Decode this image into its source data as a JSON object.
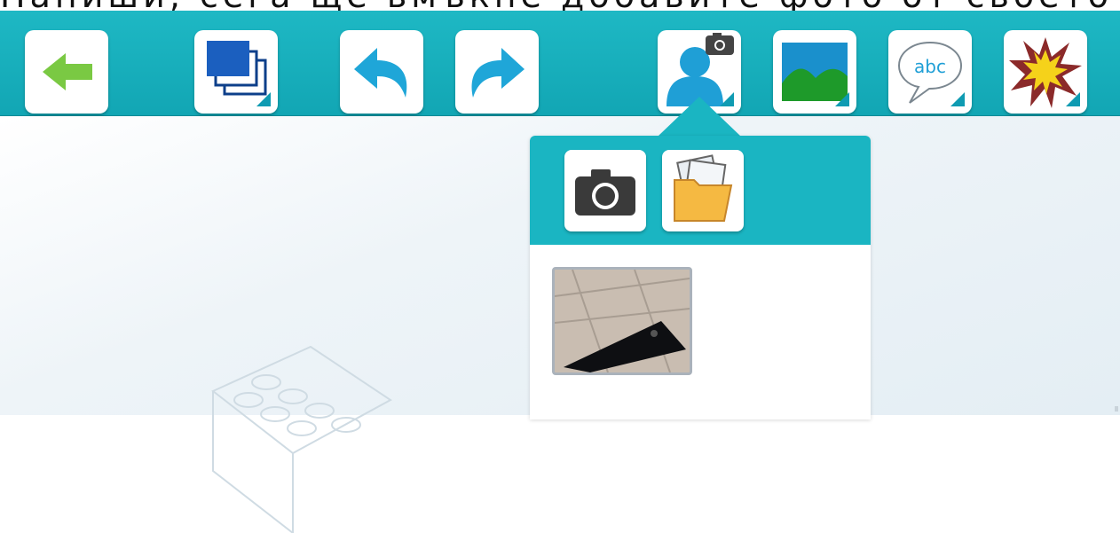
{
  "caption": {
    "text": "Напиши, сега ще вмъкне добавите фото от своето устройство"
  },
  "toolbar": {
    "buttons": [
      {
        "id": "back",
        "icon": "arrow-left-icon"
      },
      {
        "id": "layers",
        "icon": "layers-icon"
      },
      {
        "id": "undo",
        "icon": "undo-icon"
      },
      {
        "id": "redo",
        "icon": "redo-icon"
      },
      {
        "id": "character",
        "icon": "person-camera-icon"
      },
      {
        "id": "background",
        "icon": "landscape-icon"
      },
      {
        "id": "text",
        "icon": "speech-bubble-icon",
        "label": "abc"
      },
      {
        "id": "effects",
        "icon": "explosion-icon"
      }
    ]
  },
  "popup": {
    "buttons": [
      {
        "id": "camera",
        "icon": "camera-icon"
      },
      {
        "id": "gallery",
        "icon": "folder-photos-icon"
      }
    ],
    "thumbnails": [
      {
        "icon": "phone-photo-thumbnail"
      }
    ]
  },
  "colors": {
    "toolbar": "#1ab5c2",
    "corner_indicator": "#0f9bb2",
    "arrow_green": "#7ac943",
    "icon_blue": "#1f9fd6"
  }
}
